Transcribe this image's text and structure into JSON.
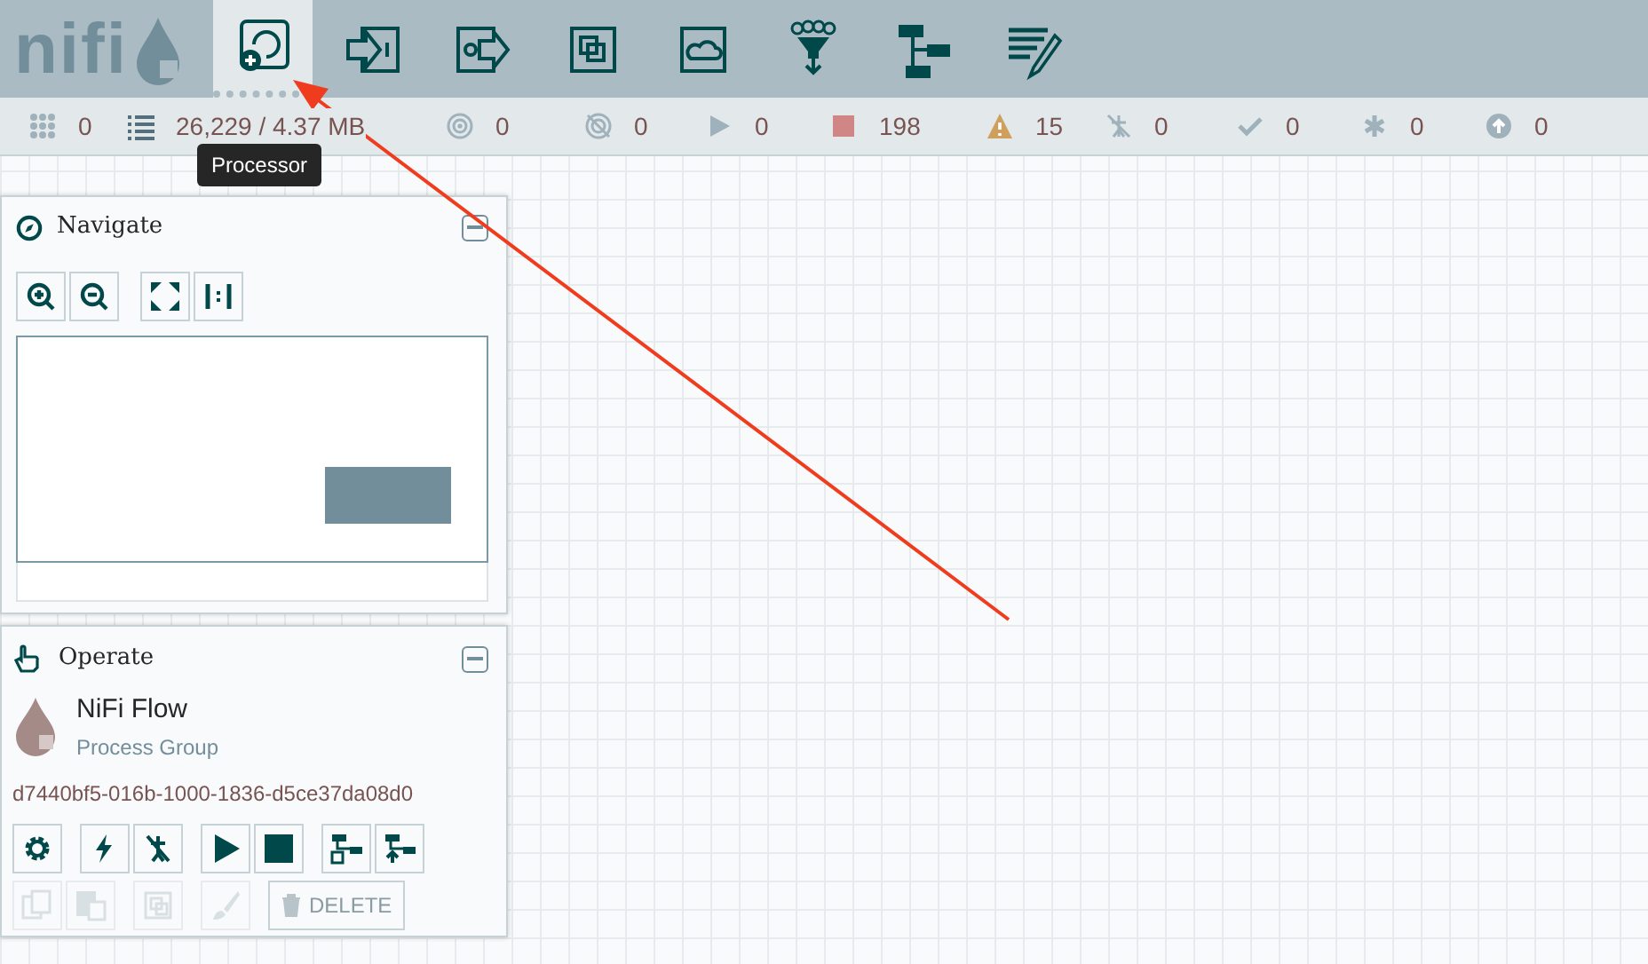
{
  "logo": {
    "text": "nifi"
  },
  "toolbar": [
    {
      "kind": "processor",
      "selected": true
    },
    {
      "kind": "input-port",
      "selected": false
    },
    {
      "kind": "output-port",
      "selected": false
    },
    {
      "kind": "process-group",
      "selected": false
    },
    {
      "kind": "remote-group",
      "selected": false
    },
    {
      "kind": "funnel",
      "selected": false
    },
    {
      "kind": "template",
      "selected": false
    },
    {
      "kind": "label",
      "selected": false
    }
  ],
  "tooltip": "Processor",
  "status": [
    {
      "kind": "threads",
      "value": "0"
    },
    {
      "kind": "queued",
      "value": "26,229 / 4.37 MB"
    },
    {
      "kind": "transmitting",
      "value": "0"
    },
    {
      "kind": "not-transmitting",
      "value": "0"
    },
    {
      "kind": "running",
      "value": "0"
    },
    {
      "kind": "stopped",
      "value": "198"
    },
    {
      "kind": "invalid",
      "value": "15"
    },
    {
      "kind": "disabled",
      "value": "0"
    },
    {
      "kind": "up-to-date",
      "value": "0"
    },
    {
      "kind": "modified",
      "value": "0"
    },
    {
      "kind": "stale",
      "value": "0"
    }
  ],
  "navigate": {
    "title": "Navigate",
    "buttons": [
      {
        "kind": "zoom-in"
      },
      {
        "kind": "zoom-out"
      },
      {
        "kind": "fit"
      },
      {
        "kind": "actual-size"
      }
    ]
  },
  "operate": {
    "title": "Operate",
    "name": "NiFi Flow",
    "type": "Process Group",
    "id": "d7440bf5-016b-1000-1836-d5ce37da08d0",
    "buttons": [
      {
        "kind": "configure",
        "disabled": false
      },
      {
        "kind": "enable",
        "disabled": false
      },
      {
        "kind": "disable",
        "disabled": false
      },
      {
        "kind": "start",
        "disabled": false
      },
      {
        "kind": "stop",
        "disabled": false
      },
      {
        "kind": "create-template",
        "disabled": false
      },
      {
        "kind": "upload-template",
        "disabled": false
      }
    ],
    "buttons_2": [
      {
        "kind": "copy",
        "disabled": true
      },
      {
        "kind": "paste",
        "disabled": true
      },
      {
        "kind": "group",
        "disabled": true
      },
      {
        "kind": "color",
        "disabled": true
      },
      {
        "kind": "delete",
        "label": "DELETE",
        "disabled": true
      }
    ]
  }
}
